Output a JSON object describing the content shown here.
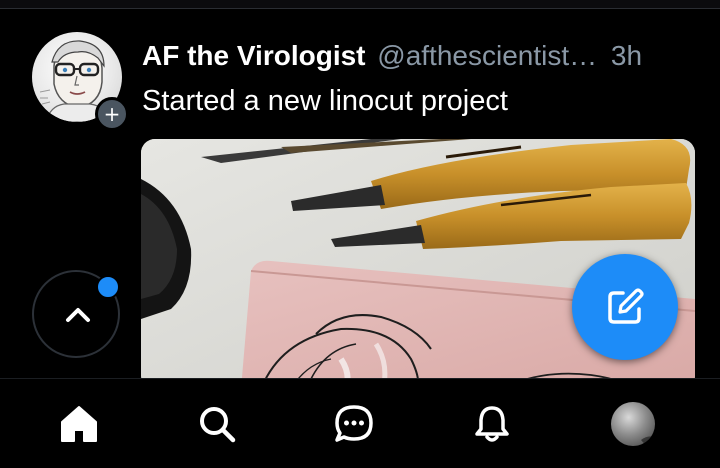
{
  "post": {
    "author": {
      "display_name": "AF the Virologist",
      "handle": "@afthescientist…",
      "avatar_icon": "user-avatar"
    },
    "timestamp": "3h",
    "text": "Started a new linocut project",
    "media": {
      "kind": "photo",
      "subject": "linocut carving tools on pink linoleum"
    }
  },
  "follow_badge": {
    "label": "+"
  },
  "scroll_top": {
    "icon": "chevron-up-icon",
    "has_new": true
  },
  "compose": {
    "icon": "compose-icon"
  },
  "bottom_nav": {
    "items": [
      {
        "id": "home",
        "icon": "home-icon",
        "active": true
      },
      {
        "id": "search",
        "icon": "search-icon",
        "active": false
      },
      {
        "id": "messages",
        "icon": "chat-bubble-icon",
        "active": false
      },
      {
        "id": "notifications",
        "icon": "bell-icon",
        "active": false
      },
      {
        "id": "profile",
        "icon": "profile-avatar",
        "active": false
      }
    ]
  },
  "colors": {
    "background": "#000000",
    "accent": "#1d8cf8",
    "text_primary": "#ffffff",
    "text_secondary": "#8a98a6"
  }
}
